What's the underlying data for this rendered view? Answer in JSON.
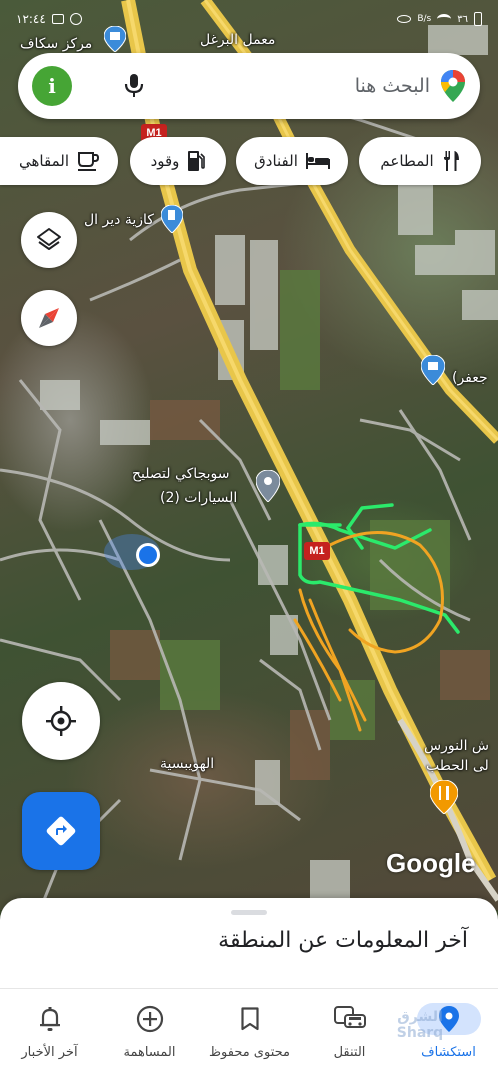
{
  "status_bar": {
    "time": "١٢:٤٤",
    "battery": "٣٦",
    "network": "B/s"
  },
  "search": {
    "placeholder": "البحث هنا",
    "avatar_letter": "i"
  },
  "chips": [
    {
      "label": "المطاعم",
      "icon": "fork-knife-icon"
    },
    {
      "label": "الفنادق",
      "icon": "bed-icon"
    },
    {
      "label": "وقود",
      "icon": "fuel-icon"
    },
    {
      "label": "المقاهي",
      "icon": "coffee-icon"
    }
  ],
  "map": {
    "labels": {
      "skaf": "مركز سكاف",
      "burghul": "معمل البرغل",
      "gas_station": "كازية دير ال",
      "jaafar": "جعفر)",
      "sobjaki_1": "سوبجاكي لتصليح",
      "sobjaki_2": "السيارات (2)",
      "houbaysieh": "الهويبسية",
      "nawras_1": "ش النورس",
      "nawras_2": "لى الحطب"
    },
    "highway_label": "M1",
    "logo": "Google"
  },
  "sheet": {
    "title": "آخر المعلومات عن المنطقة"
  },
  "bottom_nav": [
    {
      "label": "استكشاف",
      "icon": "location-pin-icon",
      "active": true
    },
    {
      "label": "التنقل",
      "icon": "car-icon",
      "active": false
    },
    {
      "label": "محتوى محفوظ",
      "icon": "bookmark-icon",
      "active": false
    },
    {
      "label": "المساهمة",
      "icon": "plus-circle-icon",
      "active": false
    },
    {
      "label": "آخر الأخبار",
      "icon": "bell-icon",
      "active": false
    }
  ],
  "watermark": {
    "line1": "الشرق",
    "line2": "Sharq"
  },
  "colors": {
    "accent": "#1a73e8",
    "highway": "#e8c64a",
    "annotation_green": "#2bea6b",
    "annotation_orange": "#f0a422"
  }
}
